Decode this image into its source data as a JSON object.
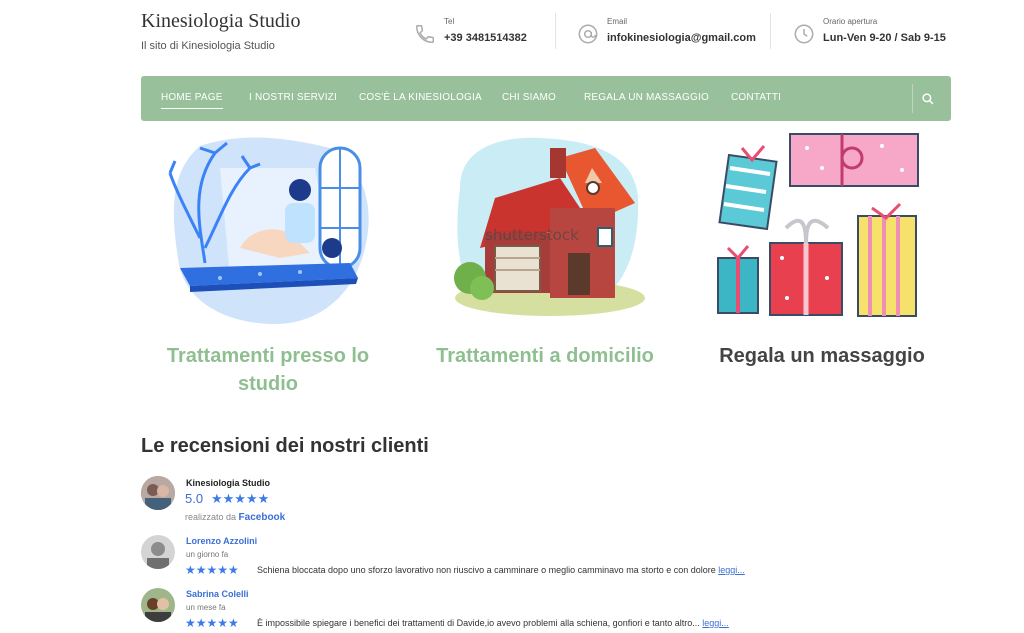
{
  "brand": {
    "title": "Kinesiologia Studio",
    "subtitle": "Il sito di Kinesiologia Studio"
  },
  "contacts": [
    {
      "label": "Tel",
      "value": "+39 3481514382",
      "icon": "phone-icon"
    },
    {
      "label": "Email",
      "value": "infokinesiologia@gmail.com",
      "icon": "at-icon"
    },
    {
      "label": "Orario apertura",
      "value": "Lun-Ven 9-20 / Sab 9-15",
      "icon": "clock-icon"
    }
  ],
  "nav": {
    "items": [
      "HOME PAGE",
      "I NOSTRI SERVIZI",
      "COS'È LA KINESIOLOGIA",
      "CHI SIAMO",
      "REGALA UN MASSAGGIO",
      "CONTATTI"
    ],
    "active": "HOME PAGE",
    "search_icon": "search-icon"
  },
  "features": [
    {
      "title": "Trattamenti presso lo studio",
      "color": "#8fbf91"
    },
    {
      "title": "Trattamenti a domicilio",
      "color": "#8fbf91"
    },
    {
      "title": "Regala un massaggio",
      "color": "#444444"
    }
  ],
  "watermark": "shutterstock",
  "reviews": {
    "heading": "Le recensioni dei nostri clienti",
    "summary": {
      "name": "Kinesiologia Studio",
      "rating": "5.0",
      "stars": "★★★★★",
      "powered_prefix": "realizzato da",
      "powered_brand": "Facebook"
    },
    "items": [
      {
        "name": "Lorenzo Azzolini",
        "when": "un giorno fa",
        "stars": "★★★★★",
        "text": "Schiena bloccata dopo uno sforzo lavorativo non riuscivo a camminare o meglio camminavo ma storto e con dolore",
        "more": "leggi..."
      },
      {
        "name": "Sabrina Colelli",
        "when": "un mese fa",
        "stars": "★★★★★",
        "text": "È impossibile spiegare i benefici dei trattamenti di Davide,io avevo problemi alla schiena, gonfiori e tanto altro...",
        "more": "leggi..."
      }
    ]
  },
  "colors": {
    "nav_bg": "#98c09a",
    "accent_green": "#8fbf91",
    "link_blue": "#3b6fd6",
    "star_blue": "#3b7ae8"
  }
}
